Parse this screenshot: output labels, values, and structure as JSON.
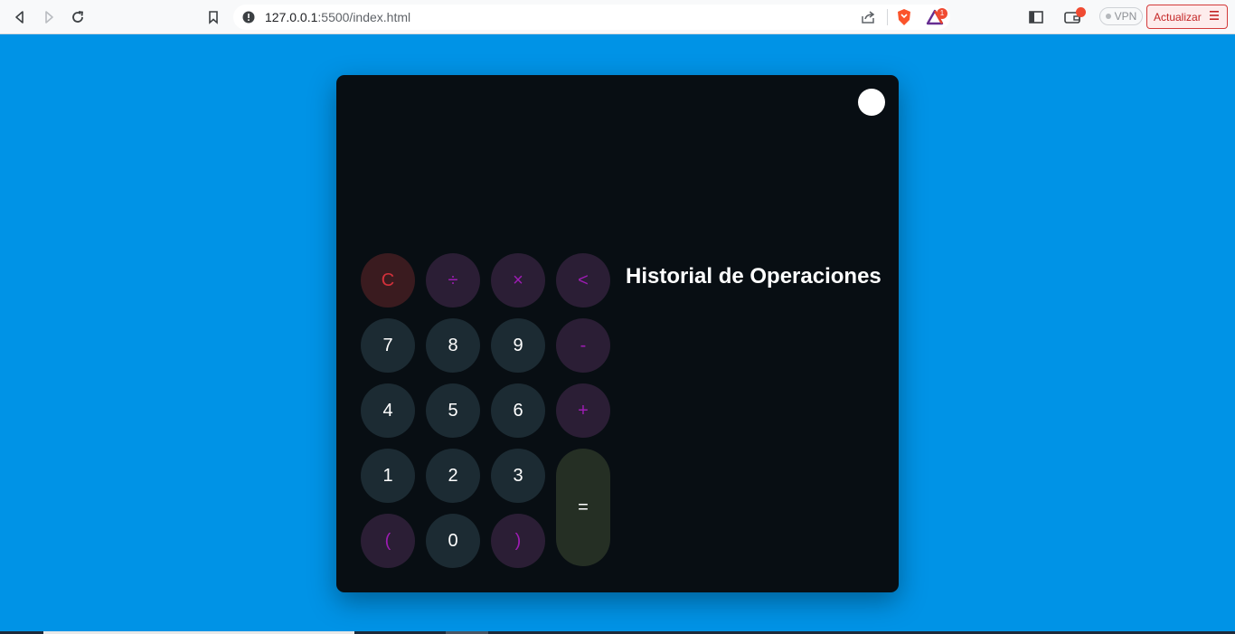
{
  "browser": {
    "url_host": "127.0.0.1",
    "url_path": ":5500/index.html",
    "vpn_label": "VPN",
    "update_label": "Actualizar",
    "rewards_badge": "1",
    "icons": [
      "back-icon",
      "forward-icon",
      "reload-icon",
      "bookmark-icon",
      "site-info-icon",
      "share-icon",
      "brave-shields-icon",
      "brave-rewards-icon",
      "sidebar-icon",
      "wallet-icon",
      "menu-icon"
    ]
  },
  "calculator": {
    "history_title": "Historial de Operaciones",
    "keys": {
      "clear": "C",
      "divide": "÷",
      "multiply": "×",
      "backspace": "<",
      "seven": "7",
      "eight": "8",
      "nine": "9",
      "minus": "-",
      "four": "4",
      "five": "5",
      "six": "6",
      "plus": "+",
      "one": "1",
      "two": "2",
      "three": "3",
      "equals": "=",
      "open_paren": "(",
      "zero": "0",
      "close_paren": ")"
    },
    "colors": {
      "page_bg": "#0093e6",
      "panel_bg": "#080e13",
      "number_key": "#1c2b33",
      "operator_key": "#2b1e35",
      "operator_text": "#9d1cb3",
      "clear_key": "#3a1b1f",
      "clear_text": "#d2313b",
      "equals_key": "#252f24"
    }
  }
}
